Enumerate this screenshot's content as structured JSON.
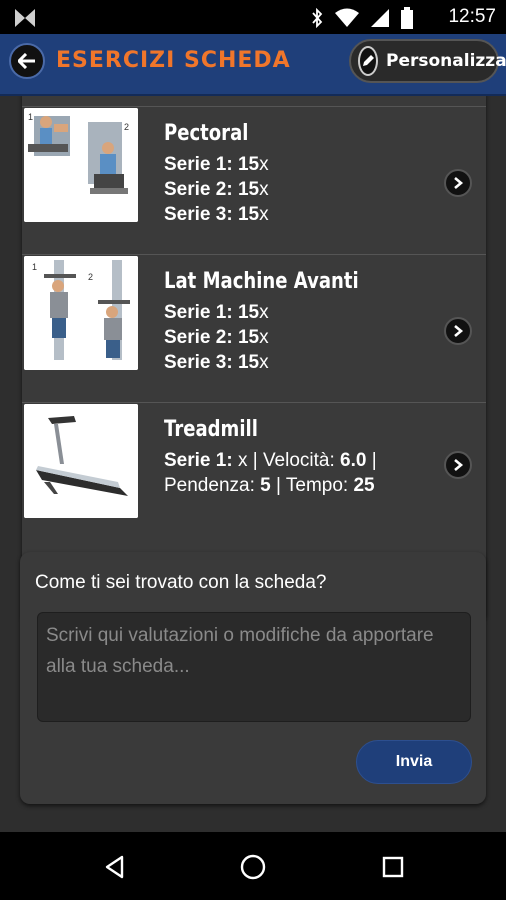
{
  "status_bar": {
    "time": "12:57",
    "icons": [
      "app-logo-icon",
      "bluetooth-icon",
      "wifi-icon",
      "signal-icon",
      "battery-icon"
    ]
  },
  "header": {
    "title": "ESERCIZI SCHEDA",
    "customize_label": "Personalizza",
    "back_icon": "back-arrow-icon",
    "edit_icon": "pencil-icon",
    "title_color": "#f0762b",
    "bar_color": "#1f3f7a"
  },
  "exercises": [
    {
      "name": "Pectoral",
      "sets": [
        {
          "label": "Serie 1",
          "value": "15",
          "unit": "x"
        },
        {
          "label": "Serie 2",
          "value": "15",
          "unit": "x"
        },
        {
          "label": "Serie 3",
          "value": "15",
          "unit": "x"
        }
      ]
    },
    {
      "name": "Lat Machine Avanti",
      "sets": [
        {
          "label": "Serie 1",
          "value": "15",
          "unit": "x"
        },
        {
          "label": "Serie 2",
          "value": "15",
          "unit": "x"
        },
        {
          "label": "Serie 3",
          "value": "15",
          "unit": "x"
        }
      ]
    },
    {
      "name": "Treadmill",
      "detail": {
        "serie_label": "Serie 1",
        "serie_value": "x",
        "speed_label": "Velocità",
        "speed_value": "6.0",
        "incline_label": "Pendenza",
        "incline_value": "5",
        "time_label": "Tempo",
        "time_value": "25"
      }
    }
  ],
  "feedback": {
    "question": "Come ti sei trovato con la scheda?",
    "placeholder": "Scrivi qui valutazioni o modifiche da apportare alla tua scheda...",
    "value": "",
    "send_label": "Invia"
  },
  "nav_bar": {
    "icons": [
      "back-triangle-icon",
      "home-circle-icon",
      "recents-square-icon"
    ]
  }
}
